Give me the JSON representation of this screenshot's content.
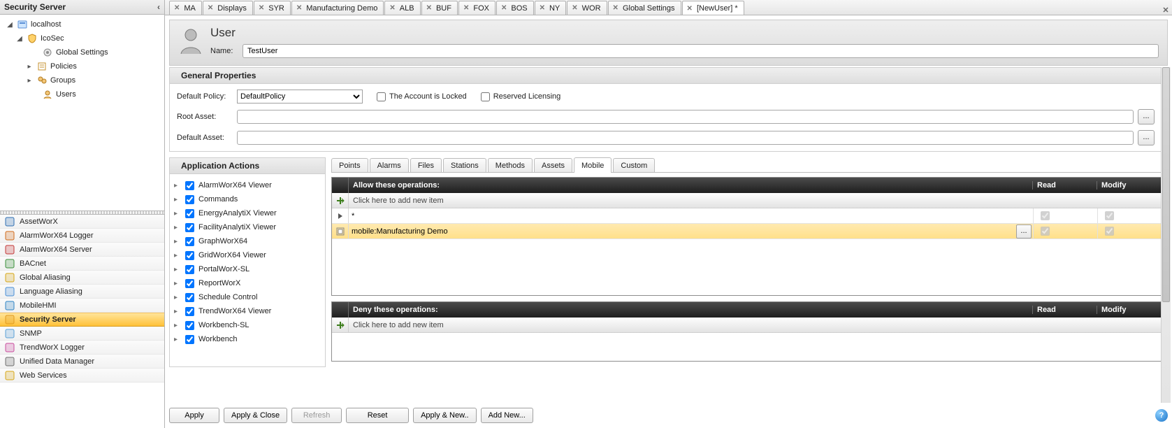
{
  "left_panel_title": "Security Server",
  "tree": {
    "root": "localhost",
    "node1": "IcoSec",
    "node1_children": {
      "a": "Global Settings",
      "b": "Policies",
      "c": "Groups",
      "d": "Users"
    }
  },
  "nav_items": [
    {
      "label": "AssetWorX",
      "selected": false
    },
    {
      "label": "AlarmWorX64 Logger",
      "selected": false
    },
    {
      "label": "AlarmWorX64 Server",
      "selected": false
    },
    {
      "label": "BACnet",
      "selected": false
    },
    {
      "label": "Global Aliasing",
      "selected": false
    },
    {
      "label": "Language Aliasing",
      "selected": false
    },
    {
      "label": "MobileHMI",
      "selected": false
    },
    {
      "label": "Security Server",
      "selected": true
    },
    {
      "label": "SNMP",
      "selected": false
    },
    {
      "label": "TrendWorX Logger",
      "selected": false
    },
    {
      "label": "Unified Data Manager",
      "selected": false
    },
    {
      "label": "Web Services",
      "selected": false
    }
  ],
  "file_tabs": [
    {
      "label": "MA"
    },
    {
      "label": "Displays"
    },
    {
      "label": "SYR"
    },
    {
      "label": "Manufacturing Demo"
    },
    {
      "label": "ALB"
    },
    {
      "label": "BUF"
    },
    {
      "label": "FOX"
    },
    {
      "label": "BOS"
    },
    {
      "label": "NY"
    },
    {
      "label": "WOR"
    },
    {
      "label": "Global Settings"
    },
    {
      "label": "[NewUser] *",
      "active": true
    }
  ],
  "user_header": {
    "title": "User",
    "name_label": "Name:",
    "name_value": "TestUser"
  },
  "general": {
    "title": "General Properties",
    "default_policy_label": "Default Policy:",
    "default_policy_value": "DefaultPolicy",
    "account_locked_label": "The Account is Locked",
    "reserved_licensing_label": "Reserved Licensing",
    "root_asset_label": "Root Asset:",
    "root_asset_value": "",
    "default_asset_label": "Default Asset:",
    "default_asset_value": ""
  },
  "app_actions": {
    "title": "Application Actions",
    "items": [
      "AlarmWorX64 Viewer",
      "Commands",
      "EnergyAnalytiX Viewer",
      "FacilityAnalytiX Viewer",
      "GraphWorX64",
      "GridWorX64 Viewer",
      "PortalWorX-SL",
      "ReportWorX",
      "Schedule Control",
      "TrendWorX64 Viewer",
      "Workbench-SL",
      "Workbench"
    ]
  },
  "inner_tabs": [
    "Points",
    "Alarms",
    "Files",
    "Stations",
    "Methods",
    "Assets",
    "Mobile",
    "Custom"
  ],
  "inner_active": "Mobile",
  "ops_allow": {
    "title": "Allow these operations:",
    "col_read": "Read",
    "col_modify": "Modify",
    "add_placeholder": "Click here to add new item",
    "rows": [
      {
        "value": "*",
        "read": true,
        "modify": true,
        "selected": false,
        "marker": ">"
      },
      {
        "value": "mobile:Manufacturing Demo",
        "read": true,
        "modify": true,
        "selected": true,
        "browse": true,
        "marker": "box"
      }
    ]
  },
  "ops_deny": {
    "title": "Deny these operations:",
    "col_read": "Read",
    "col_modify": "Modify",
    "add_placeholder": "Click here to add new item"
  },
  "buttons": {
    "apply": "Apply",
    "apply_close": "Apply & Close",
    "refresh": "Refresh",
    "reset": "Reset",
    "apply_new": "Apply & New..",
    "add_new": "Add New..."
  },
  "browse_ellipsis": "..."
}
